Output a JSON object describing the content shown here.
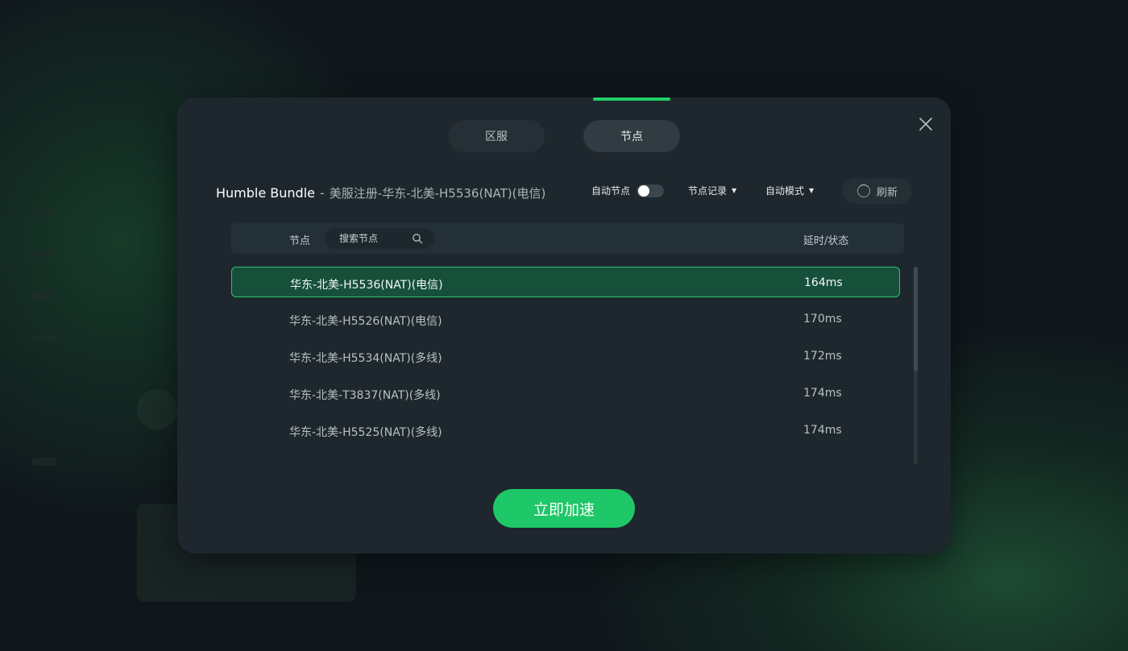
{
  "tabs": [
    {
      "label": "区服"
    },
    {
      "label": "节点"
    }
  ],
  "header": {
    "game_name": "Humble Bundle",
    "separator": "-",
    "current_node": "美服注册-华东-北美-H5536(NAT)(电信)"
  },
  "controls": {
    "auto_node_label": "自动节点",
    "auto_node_on": false,
    "node_record_label": "节点记录",
    "auto_mode_label": "自动模式",
    "refresh_label": "刷新"
  },
  "table": {
    "node_header": "节点",
    "search_placeholder": "搜索节点",
    "latency_header": "延时/状态"
  },
  "nodes": [
    {
      "name": "华东-北美-H5536(NAT)(电信)",
      "latency": "164ms",
      "selected": true
    },
    {
      "name": "华东-北美-H5526(NAT)(电信)",
      "latency": "170ms",
      "selected": false
    },
    {
      "name": "华东-北美-H5534(NAT)(多线)",
      "latency": "172ms",
      "selected": false
    },
    {
      "name": "华东-北美-T3837(NAT)(多线)",
      "latency": "174ms",
      "selected": false
    },
    {
      "name": "华东-北美-H5525(NAT)(多线)",
      "latency": "174ms",
      "selected": false
    }
  ],
  "accelerate_label": "立即加速",
  "colors": {
    "accent": "#1ec767",
    "selected_row": "#17503a",
    "modal_bg": "#1e272d"
  }
}
